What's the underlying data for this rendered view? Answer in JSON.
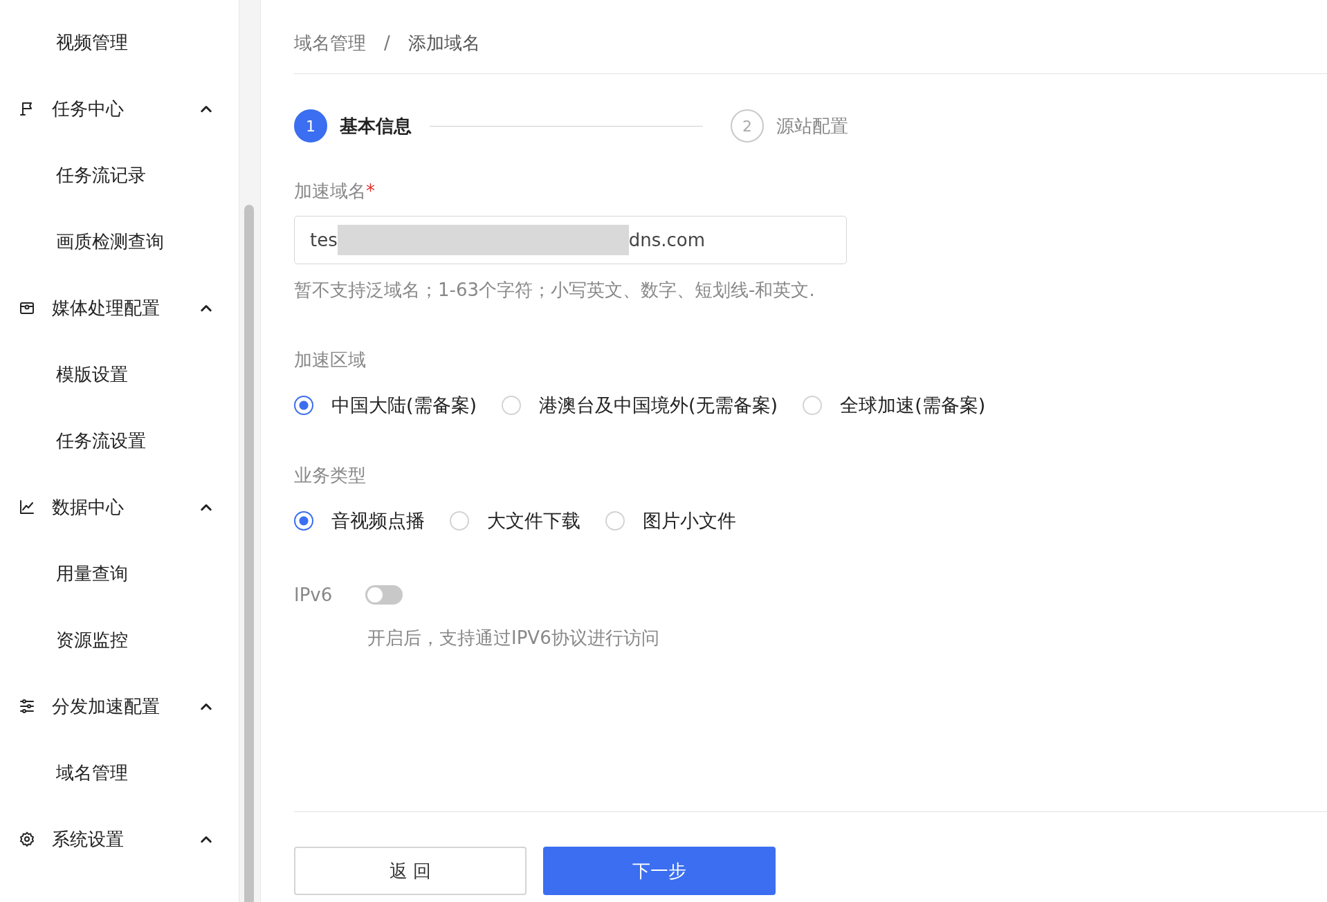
{
  "sidebar": {
    "items": [
      {
        "label": "视频管理",
        "kind": "child"
      },
      {
        "label": "任务中心",
        "kind": "group",
        "expanded": true
      },
      {
        "label": "任务流记录",
        "kind": "child"
      },
      {
        "label": "画质检测查询",
        "kind": "child"
      },
      {
        "label": "媒体处理配置",
        "kind": "group",
        "expanded": true
      },
      {
        "label": "模版设置",
        "kind": "child"
      },
      {
        "label": "任务流设置",
        "kind": "child"
      },
      {
        "label": "数据中心",
        "kind": "group",
        "expanded": true
      },
      {
        "label": "用量查询",
        "kind": "child"
      },
      {
        "label": "资源监控",
        "kind": "child"
      },
      {
        "label": "分发加速配置",
        "kind": "group",
        "expanded": true
      },
      {
        "label": "域名管理",
        "kind": "child"
      },
      {
        "label": "系统设置",
        "kind": "group",
        "expanded": true
      }
    ]
  },
  "breadcrumb": {
    "items": [
      "域名管理",
      "添加域名"
    ],
    "separator": "/"
  },
  "steps": [
    {
      "number": "1",
      "label": "基本信息",
      "selected": true
    },
    {
      "number": "2",
      "label": "源站配置",
      "selected": false
    }
  ],
  "form": {
    "domain": {
      "label": "加速域名",
      "required_mark": "*",
      "value_start": "tes",
      "value_end": "dns.com",
      "help": "暂不支持泛域名；1-63个字符；小写英文、数字、短划线-和英文."
    },
    "region": {
      "label": "加速区域",
      "options": [
        {
          "label": "中国大陆(需备案)",
          "selected": true
        },
        {
          "label": "港澳台及中国境外(无需备案)",
          "selected": false
        },
        {
          "label": "全球加速(需备案)",
          "selected": false
        }
      ]
    },
    "business": {
      "label": "业务类型",
      "options": [
        {
          "label": "音视频点播",
          "selected": true
        },
        {
          "label": "大文件下载",
          "selected": false
        },
        {
          "label": "图片小文件",
          "selected": false
        }
      ]
    },
    "ipv6": {
      "label": "IPv6",
      "on": false,
      "help": "开启后，支持通过IPV6协议进行访问"
    }
  },
  "buttons": [
    {
      "label": "返 回",
      "kind": "secondary"
    },
    {
      "label": "下一步",
      "kind": "primary"
    }
  ]
}
